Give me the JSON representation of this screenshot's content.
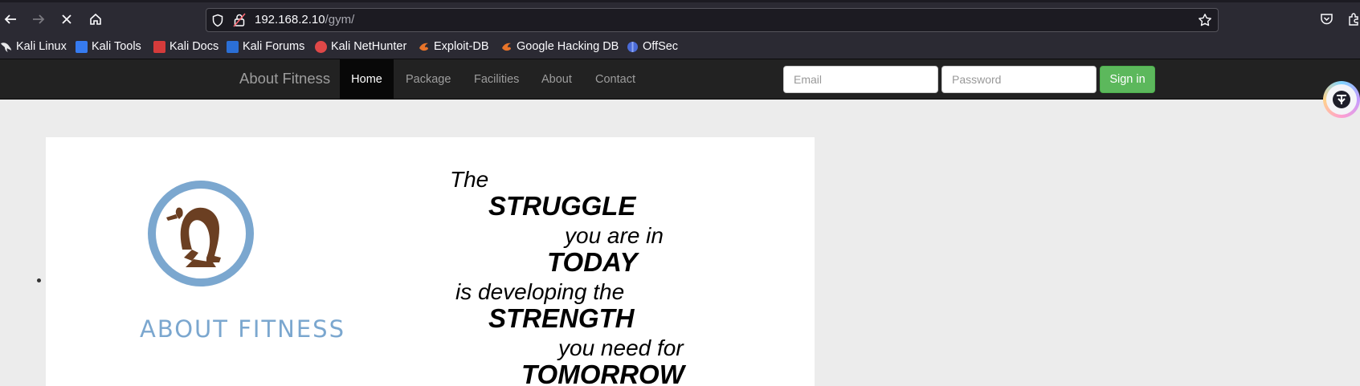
{
  "browser": {
    "url_host": "192.168.2.10",
    "url_path": "/gym/",
    "bookmarks": [
      {
        "label": "Kali Linux",
        "color": "#3a3a3a"
      },
      {
        "label": "Kali Tools",
        "color": "#367bf0"
      },
      {
        "label": "Kali Docs",
        "color": "#d63b3b"
      },
      {
        "label": "Kali Forums",
        "color": "#2b6fd6"
      },
      {
        "label": "Kali NetHunter",
        "color": "#e04848"
      },
      {
        "label": "Exploit-DB",
        "color": "#e8742a"
      },
      {
        "label": "Google Hacking DB",
        "color": "#e8742a"
      },
      {
        "label": "OffSec",
        "color": "#4a6bd8"
      }
    ]
  },
  "navbar": {
    "brand": "About Fitness",
    "items": [
      {
        "label": "Home",
        "active": true
      },
      {
        "label": "Package",
        "active": false
      },
      {
        "label": "Facilities",
        "active": false
      },
      {
        "label": "About",
        "active": false
      },
      {
        "label": "Contact",
        "active": false
      }
    ],
    "email_placeholder": "Email",
    "password_placeholder": "Password",
    "signin_label": "Sign in"
  },
  "slide": {
    "logo_text": "ABOUT FITNESS",
    "quote": [
      "The",
      "STRUGGLE",
      "you are in",
      "TODAY",
      "is developing the",
      "STRENGTH",
      "you need for",
      "TOMORROW"
    ]
  },
  "colors": {
    "brand_blue": "#7ba7cf",
    "figure_brown": "#6b3f22",
    "signin_green": "#5cb85c"
  }
}
